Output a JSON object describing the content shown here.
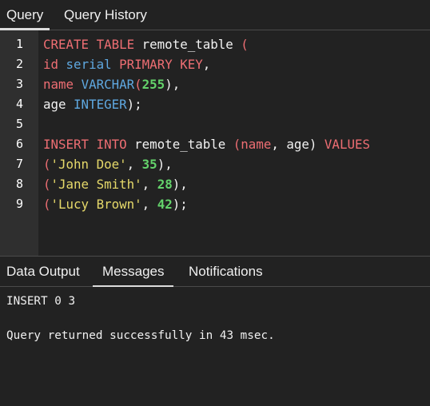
{
  "top_tabs": {
    "query": "Query",
    "query_history": "Query History",
    "active": "Query"
  },
  "editor": {
    "line_numbers": [
      "1",
      "2",
      "3",
      "4",
      "5",
      "6",
      "7",
      "8",
      "9"
    ],
    "lines": [
      [
        {
          "t": "CREATE TABLE",
          "c": "kw"
        },
        {
          "t": " remote_table ",
          "c": "ident"
        },
        {
          "t": "(",
          "c": "pn"
        }
      ],
      [
        {
          "t": "id",
          "c": "kw"
        },
        {
          "t": " ",
          "c": "ident"
        },
        {
          "t": "serial",
          "c": "type"
        },
        {
          "t": " ",
          "c": "ident"
        },
        {
          "t": "PRIMARY KEY",
          "c": "kw"
        },
        {
          "t": ",",
          "c": "ident"
        }
      ],
      [
        {
          "t": "name",
          "c": "kw"
        },
        {
          "t": " ",
          "c": "ident"
        },
        {
          "t": "VARCHAR",
          "c": "type"
        },
        {
          "t": "(",
          "c": "pn"
        },
        {
          "t": "255",
          "c": "num"
        },
        {
          "t": "),",
          "c": "ident"
        }
      ],
      [
        {
          "t": "age ",
          "c": "ident"
        },
        {
          "t": "INTEGER",
          "c": "type"
        },
        {
          "t": ");",
          "c": "ident"
        }
      ],
      [],
      [
        {
          "t": "INSERT INTO",
          "c": "kw"
        },
        {
          "t": " remote_table ",
          "c": "ident"
        },
        {
          "t": "(",
          "c": "pn"
        },
        {
          "t": "name",
          "c": "kw"
        },
        {
          "t": ", age) ",
          "c": "ident"
        },
        {
          "t": "VALUES",
          "c": "kw"
        }
      ],
      [
        {
          "t": "(",
          "c": "pn"
        },
        {
          "t": "'John Doe'",
          "c": "str"
        },
        {
          "t": ", ",
          "c": "ident"
        },
        {
          "t": "35",
          "c": "num"
        },
        {
          "t": "),",
          "c": "ident"
        }
      ],
      [
        {
          "t": "(",
          "c": "pn"
        },
        {
          "t": "'Jane Smith'",
          "c": "str"
        },
        {
          "t": ", ",
          "c": "ident"
        },
        {
          "t": "28",
          "c": "num"
        },
        {
          "t": "),",
          "c": "ident"
        }
      ],
      [
        {
          "t": "(",
          "c": "pn"
        },
        {
          "t": "'Lucy Brown'",
          "c": "str"
        },
        {
          "t": ", ",
          "c": "ident"
        },
        {
          "t": "42",
          "c": "num"
        },
        {
          "t": ");",
          "c": "ident"
        }
      ]
    ]
  },
  "bottom_tabs": {
    "data_output": "Data Output",
    "messages": "Messages",
    "notifications": "Notifications",
    "active": "Messages"
  },
  "messages": {
    "line1": "INSERT 0 3",
    "line2": "Query returned successfully in 43 msec."
  },
  "colors": {
    "background": "#222222",
    "gutter": "#2f2f2f",
    "keyword": "#ee6e73",
    "type": "#5fa8e0",
    "number": "#64d36b",
    "string": "#e6d96a",
    "text": "#f2f2f2"
  }
}
